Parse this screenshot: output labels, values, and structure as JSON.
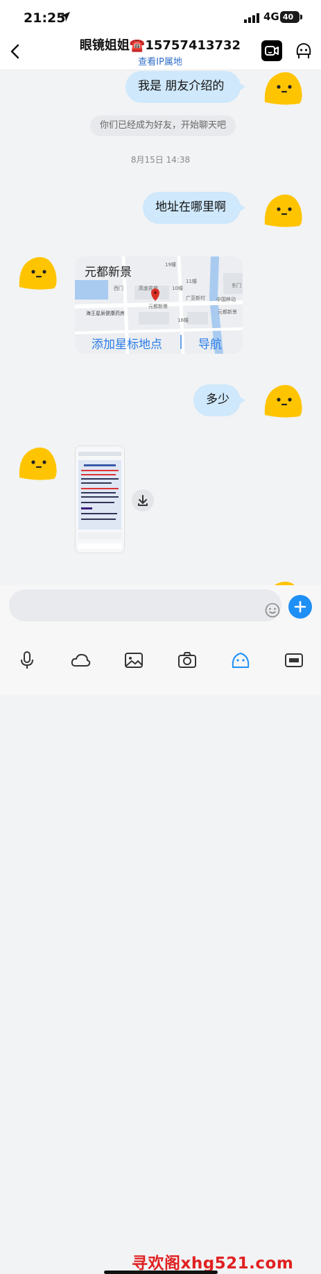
{
  "status": {
    "time": "21:25",
    "network": "4G",
    "battery": "40"
  },
  "header": {
    "title": "眼镜姐姐☎️15757413732",
    "subtitle": "查看IP属地"
  },
  "messages": {
    "msg1": "我是 朋友介绍的",
    "system": "你们已经成为好友，开始聊天吧",
    "timestamp": "8月15日 14:38",
    "msg2": "地址在哪里啊",
    "msg3": "多少"
  },
  "location": {
    "title": "元都新景",
    "add_star": "添加星标地点",
    "navigate": "导航",
    "map_labels": [
      "高金花苑",
      "西门",
      "10幢",
      "11幢",
      "广亚新村",
      "中国移动",
      "元都新景",
      "海王星辰健康药房",
      "元都新景",
      "16幢",
      "19幢",
      "东门"
    ]
  },
  "watermark": "寻欢阁xhg521.com",
  "colors": {
    "accent": "#1e8ff5",
    "bubble": "#cfe8fb",
    "link": "#2b7de9"
  }
}
